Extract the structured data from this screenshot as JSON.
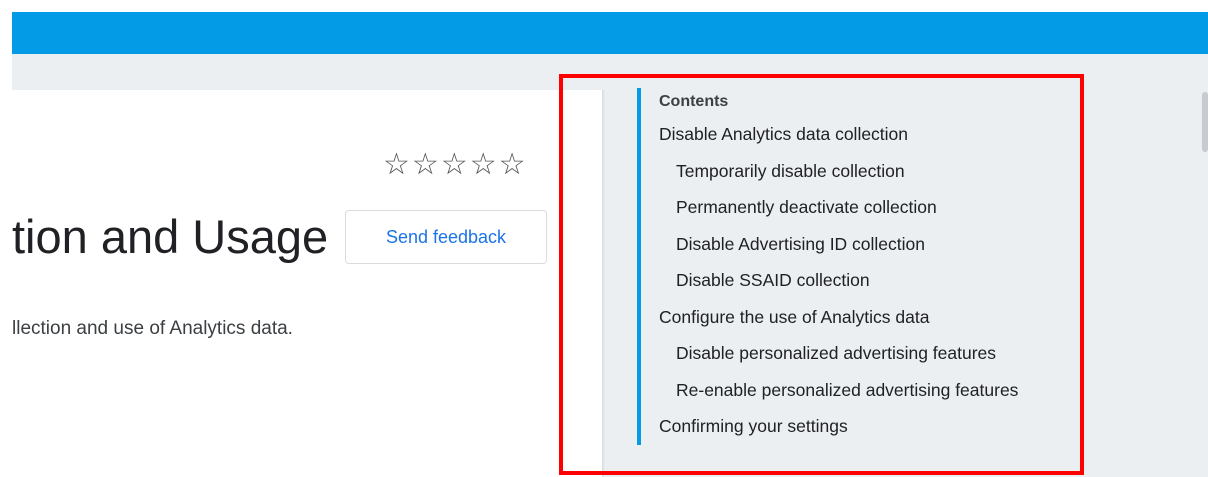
{
  "header": {
    "bar_color": "#039be5"
  },
  "article": {
    "title_fragment": "tion and Usage",
    "description_fragment": "llection and use of Analytics data.",
    "feedback_button": "Send feedback",
    "rating": {
      "stars": [
        "☆",
        "☆",
        "☆",
        "☆",
        "☆"
      ],
      "value": 0,
      "max": 5
    }
  },
  "toc": {
    "heading": "Contents",
    "items": [
      {
        "label": "Disable Analytics data collection",
        "level": 1
      },
      {
        "label": "Temporarily disable collection",
        "level": 2
      },
      {
        "label": "Permanently deactivate collection",
        "level": 2
      },
      {
        "label": "Disable Advertising ID collection",
        "level": 2
      },
      {
        "label": "Disable SSAID collection",
        "level": 2
      },
      {
        "label": "Configure the use of Analytics data",
        "level": 1
      },
      {
        "label": "Disable personalized advertising features",
        "level": 2
      },
      {
        "label": "Re-enable personalized advertising features",
        "level": 2
      },
      {
        "label": "Confirming your settings",
        "level": 1
      }
    ],
    "accent_color": "#039be5"
  },
  "annotation": {
    "highlight_color": "#ff0000"
  }
}
